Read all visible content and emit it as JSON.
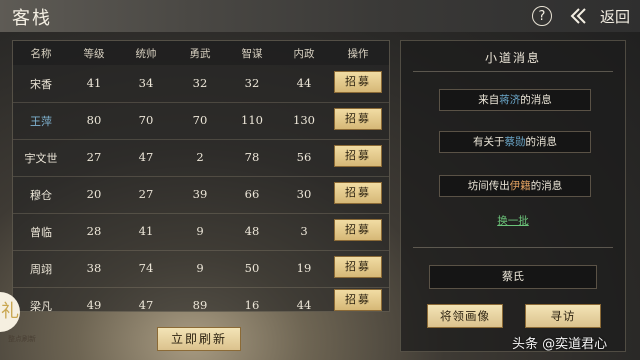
{
  "header": {
    "title": "客栈",
    "help_label": "?",
    "back_label": "返回"
  },
  "table": {
    "columns": [
      "名称",
      "等级",
      "统帅",
      "勇武",
      "智谋",
      "内政",
      "操作"
    ],
    "recruit_label": "招募",
    "rows": [
      {
        "name": "宋香",
        "level": "41",
        "command": "34",
        "valor": "32",
        "wisdom": "32",
        "politics": "44"
      },
      {
        "name": "王萍",
        "level": "80",
        "command": "70",
        "valor": "70",
        "wisdom": "110",
        "politics": "130"
      },
      {
        "name": "宇文世",
        "level": "27",
        "command": "47",
        "valor": "2",
        "wisdom": "78",
        "politics": "56"
      },
      {
        "name": "穆仓",
        "level": "20",
        "command": "27",
        "valor": "39",
        "wisdom": "66",
        "politics": "30"
      },
      {
        "name": "曾临",
        "level": "28",
        "command": "41",
        "valor": "9",
        "wisdom": "48",
        "politics": "3"
      },
      {
        "name": "周翊",
        "level": "38",
        "command": "74",
        "valor": "9",
        "wisdom": "50",
        "politics": "19"
      },
      {
        "name": "梁凡",
        "level": "49",
        "command": "47",
        "valor": "89",
        "wisdom": "16",
        "politics": "44"
      }
    ]
  },
  "refresh_label": "立即刷新",
  "gift": {
    "icon": "gift-icon",
    "label": "整点刷新"
  },
  "news": {
    "title": "小道消息",
    "msg1": {
      "prefix": "来自",
      "name": "蒋济",
      "suffix": "的消息"
    },
    "msg2": {
      "prefix": "有关于",
      "name": "蔡勋",
      "suffix": "的消息"
    },
    "msg3": {
      "prefix": "坊间传出",
      "name": "伊籍",
      "suffix": "的消息"
    },
    "swap_label": "换一批",
    "selected_name": "蔡氏",
    "portrait_label": "将领画像",
    "visit_label": "寻访"
  },
  "watermark": "头条 @奕道君心",
  "colors": {
    "accent_gold": "#dbc28d",
    "highlight_blue": "#6aa6c8",
    "highlight_orange": "#e0a060",
    "link_green": "#6cc47a"
  }
}
